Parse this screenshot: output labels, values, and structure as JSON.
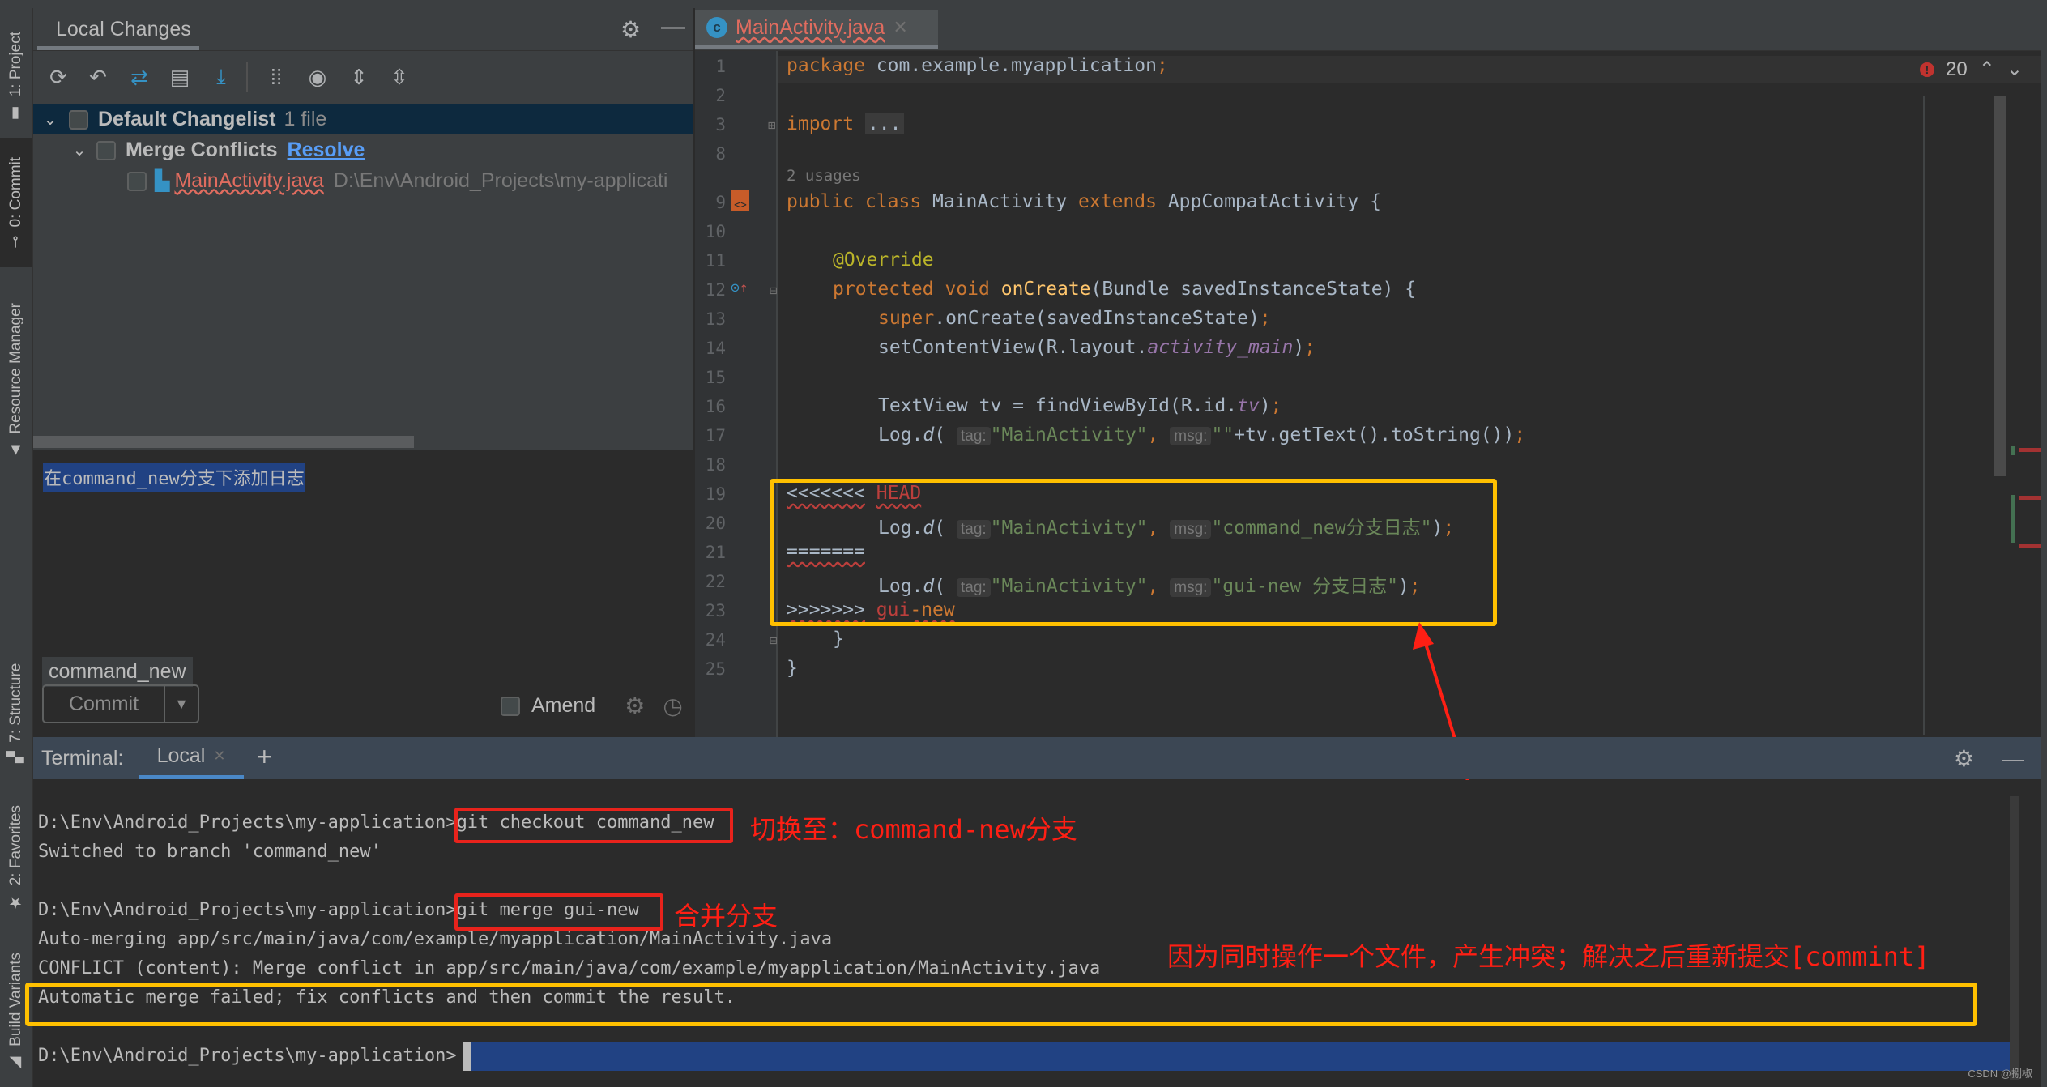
{
  "sidebar_left": {
    "tabs": [
      {
        "label": "1: Project",
        "icon": "folder-icon"
      },
      {
        "label": "0: Commit",
        "icon": "commit-icon",
        "active": true
      },
      {
        "label": "Resource Manager",
        "icon": "resource-manager-icon"
      },
      {
        "label": "7: Structure",
        "icon": "structure-icon"
      },
      {
        "label": "2: Favorites",
        "icon": "star-icon"
      },
      {
        "label": "Build Variants",
        "icon": "android-icon"
      }
    ]
  },
  "commit_panel": {
    "title": "Local Changes",
    "toolbar": [
      "refresh-icon",
      "rollback-icon",
      "merge-icon",
      "show-diff-icon",
      "update-icon",
      "group-by-icon",
      "view-options-icon",
      "expand-all-icon",
      "collapse-all-icon"
    ],
    "tree": {
      "changelist": {
        "name": "Default Changelist",
        "count": "1 file"
      },
      "group": {
        "name": "Merge Conflicts",
        "action": "Resolve"
      },
      "file": {
        "name": "MainActivity.java",
        "path": "D:\\Env\\Android_Projects\\my-applicati"
      }
    },
    "commit_message": "在command_new分支下添加日志",
    "branch": "command_new",
    "commit_label": "Commit",
    "amend_label": "Amend"
  },
  "editor": {
    "tab": {
      "icon_letter": "c",
      "filename": "MainActivity.java"
    },
    "error_count": "20",
    "usages_hint": "2 usages",
    "lines": {
      "l1": {
        "n": "1",
        "kw": "package",
        "rest": " com.example.myapplication",
        "semi": ";"
      },
      "l2": {
        "n": "2"
      },
      "l3": {
        "n": "3",
        "kw": "import",
        "fold": "..."
      },
      "l8": {
        "n": "8"
      },
      "l9": {
        "n": "9",
        "kw1": "public class",
        "cls": " MainActivity ",
        "kw2": "extends",
        "rest": " AppCompatActivity {"
      },
      "l10": {
        "n": "10"
      },
      "l11": {
        "n": "11",
        "ann": "@Override"
      },
      "l12": {
        "n": "12",
        "kw": "protected void",
        "fn": "onCreate",
        "rest": "(Bundle savedInstanceState) {"
      },
      "l13": {
        "n": "13",
        "kw": "super",
        "rest": ".onCreate(savedInstanceState)",
        "semi": ";"
      },
      "l14": {
        "n": "14",
        "a": "setContentView(R.layout.",
        "fld": "activity_main",
        "b": ")",
        "semi": ";"
      },
      "l15": {
        "n": "15"
      },
      "l16": {
        "n": "16",
        "a": "TextView tv = findViewById(R.id.",
        "fld": "tv",
        "b": ")",
        "semi": ";"
      },
      "l17": {
        "n": "17",
        "a": "Log.",
        "d": "d",
        "p": "(",
        "tag": "tag:",
        "s1": "\"MainActivity\"",
        "comma": ",",
        "msg": "msg:",
        "s2": "\"\"",
        "rest": "+tv.getText().toString())",
        "semi": ";"
      },
      "l18": {
        "n": "18"
      },
      "l19": {
        "n": "19",
        "marker": "<<<<<<<",
        "ref": "HEAD"
      },
      "l20": {
        "n": "20",
        "a": "Log.",
        "d": "d",
        "p": "(",
        "tag": "tag:",
        "s1": "\"MainActivity\"",
        "comma": ",",
        "msg": "msg:",
        "s2": "\"command_new分支日志\"",
        "rest": ")",
        "semi": ";"
      },
      "l21": {
        "n": "21",
        "marker": "======="
      },
      "l22": {
        "n": "22",
        "a": "Log.",
        "d": "d",
        "p": "(",
        "tag": "tag:",
        "s1": "\"MainActivity\"",
        "comma": ",",
        "msg": "msg:",
        "s2": "\"gui-new 分支日志\"",
        "rest": ")",
        "semi": ";"
      },
      "l23": {
        "n": "23",
        "marker": ">>>>>>>",
        "ref1": "gui",
        "ref2": "-new"
      },
      "l24": {
        "n": "24",
        "text": "}"
      },
      "l25": {
        "n": "25",
        "text": "}"
      }
    }
  },
  "terminal": {
    "label": "Terminal:",
    "tab": "Local",
    "lines": {
      "prompt1": "D:\\Env\\Android_Projects\\my-application>",
      "cmd1": "git checkout command_new",
      "out1": "Switched to branch 'command_new'",
      "prompt2": "D:\\Env\\Android_Projects\\my-application>",
      "cmd2": "git merge gui-new",
      "out2": "Auto-merging app/src/main/java/com/example/myapplication/MainActivity.java",
      "out3": "CONFLICT (content): Merge conflict in app/src/main/java/com/example/myapplication/MainActivity.java",
      "out4": "Automatic merge failed; fix conflicts and then commit the result.",
      "prompt3": "D:\\Env\\Android_Projects\\my-application>"
    }
  },
  "annotations": {
    "switch_note": "切换至：command-new分支",
    "merge_note": "合并分支",
    "conflict_note": "因为同时操作一个文件，产生冲突；解决之后重新提交[commint]",
    "colors": {
      "red": "#ff1f14",
      "yellow": "#ffc000"
    }
  },
  "watermark": "CSDN @捌椒"
}
